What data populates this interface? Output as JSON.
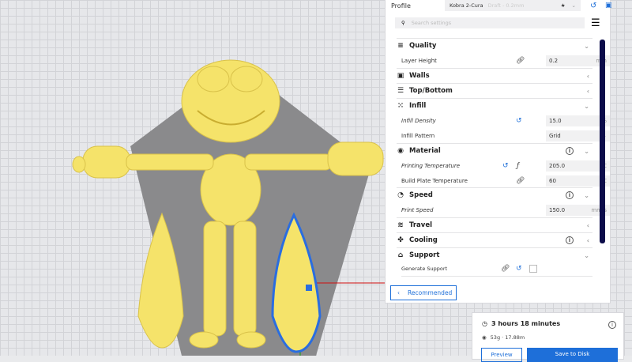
{
  "header": {
    "profile_label": "Profile",
    "profile_name": "Kobra 2-Cura",
    "profile_quality": "Draft - 0.2mm"
  },
  "search": {
    "placeholder": "Search settings"
  },
  "sections": {
    "quality": {
      "label": "Quality",
      "layer_height_label": "Layer Height",
      "layer_height": "0.2",
      "layer_height_unit": "mm"
    },
    "walls": {
      "label": "Walls"
    },
    "top_bottom": {
      "label": "Top/Bottom"
    },
    "infill": {
      "label": "Infill",
      "density_label": "Infill Density",
      "density": "15.0",
      "density_unit": "%",
      "pattern_label": "Infill Pattern",
      "pattern": "Grid"
    },
    "material": {
      "label": "Material",
      "print_temp_label": "Printing Temperature",
      "print_temp": "205.0",
      "print_temp_unit": "°C",
      "bed_temp_label": "Build Plate Temperature",
      "bed_temp": "60",
      "bed_temp_unit": "°C"
    },
    "speed": {
      "label": "Speed",
      "print_speed_label": "Print Speed",
      "print_speed": "150.0",
      "print_speed_unit": "mm/s"
    },
    "travel": {
      "label": "Travel"
    },
    "cooling": {
      "label": "Cooling"
    },
    "support": {
      "label": "Support",
      "generate_label": "Generate Support"
    }
  },
  "recommended_label": "Recommended",
  "estimate": {
    "time": "3 hours 18 minutes",
    "material": "53g · 17.88m",
    "preview_label": "Preview",
    "save_label": "Save to Disk"
  },
  "colors": {
    "model": "#f5e36a",
    "accent": "#1e6fd9",
    "scrollbar": "#0c0c4a"
  }
}
